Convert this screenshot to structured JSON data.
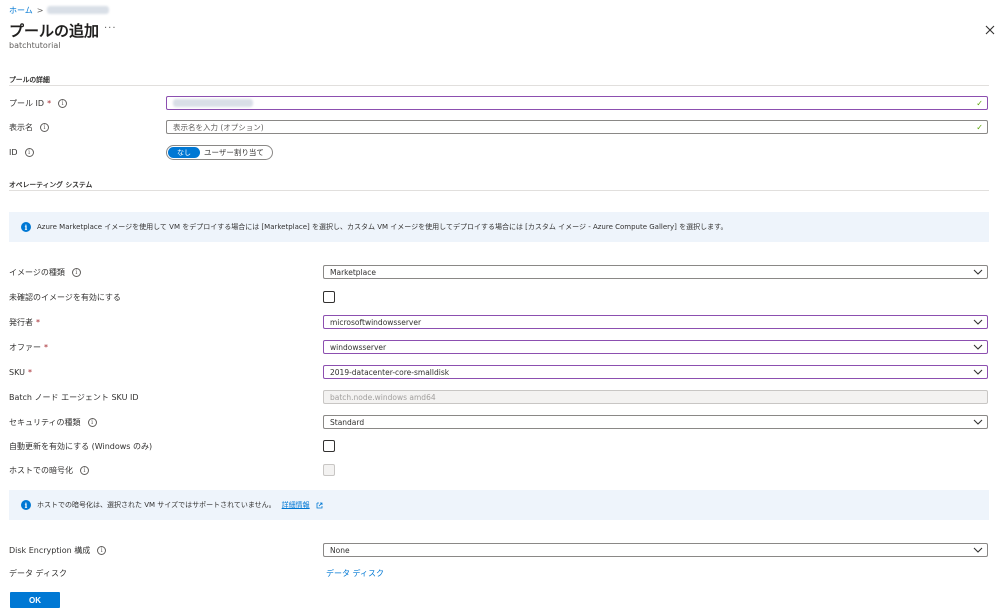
{
  "breadcrumb": {
    "home": "ホーム",
    "separator": ">"
  },
  "header": {
    "title": "プールの追加",
    "more": "···",
    "subtitle": "batchtutorial"
  },
  "sections": {
    "pool_details": "プールの詳細",
    "os": "オペレーティング システム"
  },
  "fields": {
    "pool_id": {
      "label": "プール ID",
      "required": "*"
    },
    "display_name": {
      "label": "表示名",
      "placeholder": "表示名を入力 (オプション)"
    },
    "identity": {
      "label": "ID",
      "option_on": "なし",
      "option_off": "ユーザー割り当て"
    },
    "image_type": {
      "label": "イメージの種類",
      "value": "Marketplace"
    },
    "unverified": {
      "label": "未確認のイメージを有効にする"
    },
    "publisher": {
      "label": "発行者",
      "required": "*",
      "value": "microsoftwindowsserver"
    },
    "offer": {
      "label": "オファー",
      "required": "*",
      "value": "windowsserver"
    },
    "sku": {
      "label": "SKU",
      "required": "*",
      "value": "2019-datacenter-core-smalldisk"
    },
    "agent_sku": {
      "label": "Batch ノード エージェント SKU ID",
      "value": "batch.node.windows amd64"
    },
    "security_type": {
      "label": "セキュリティの種類",
      "value": "Standard"
    },
    "auto_update": {
      "label": "自動更新を有効にする (Windows のみ)"
    },
    "host_encryption": {
      "label": "ホストでの暗号化"
    },
    "disk_encryption": {
      "label": "Disk Encryption 構成",
      "value": "None"
    },
    "data_disk": {
      "label": "データ ディスク",
      "link": "データ ディスク"
    }
  },
  "banners": {
    "marketplace_info": "Azure Marketplace イメージを使用して VM をデプロイする場合には [Marketplace] を選択し、カスタム VM イメージを使用してデプロイする場合には [カスタム イメージ - Azure Compute Gallery] を選択します。",
    "host_encryption_info": "ホストでの暗号化は、選択された VM サイズではサポートされていません。",
    "host_encryption_link": "詳細情報"
  },
  "footer": {
    "ok_label": "OK"
  },
  "colors": {
    "accent": "#0078d4",
    "focus_border": "#8c4fb0",
    "valid": "#57a300",
    "banner_bg": "#eef4fb"
  }
}
